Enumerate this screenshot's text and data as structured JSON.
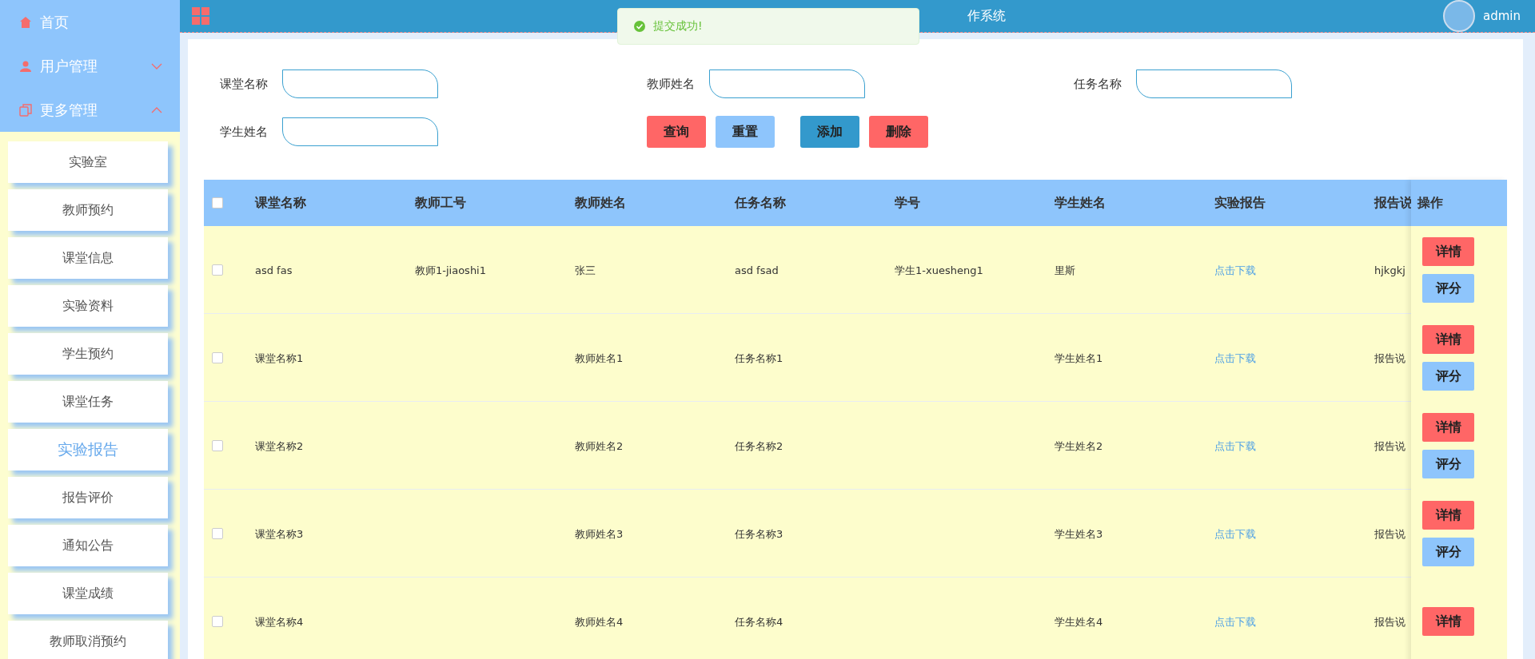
{
  "header": {
    "title_fragment": "作系统",
    "user": "admin"
  },
  "toast": {
    "message": "提交成功!"
  },
  "sidebar": {
    "items": [
      {
        "label": "首页",
        "kind": "link"
      },
      {
        "label": "用户管理",
        "kind": "group",
        "expanded": false
      },
      {
        "label": "更多管理",
        "kind": "group",
        "expanded": true,
        "children": [
          {
            "label": "实验室",
            "selected": false
          },
          {
            "label": "教师预约",
            "selected": false
          },
          {
            "label": "课堂信息",
            "selected": false
          },
          {
            "label": "实验资料",
            "selected": false
          },
          {
            "label": "学生预约",
            "selected": false
          },
          {
            "label": "课堂任务",
            "selected": false
          },
          {
            "label": "实验报告",
            "selected": true
          },
          {
            "label": "报告评价",
            "selected": false
          },
          {
            "label": "通知公告",
            "selected": false
          },
          {
            "label": "课堂成绩",
            "selected": false
          },
          {
            "label": "教师取消预约",
            "selected": false
          }
        ]
      }
    ]
  },
  "search": {
    "fields": [
      {
        "label": "课堂名称"
      },
      {
        "label": "教师姓名"
      },
      {
        "label": "任务名称"
      },
      {
        "label": "学生姓名"
      }
    ],
    "buttons": [
      {
        "label": "查询",
        "kind": "danger"
      },
      {
        "label": "重置",
        "kind": "light"
      },
      {
        "label": "添加",
        "kind": "primary"
      },
      {
        "label": "删除",
        "kind": "danger"
      }
    ]
  },
  "table": {
    "select_all": false,
    "columns": [
      "课堂名称",
      "教师工号",
      "教师姓名",
      "任务名称",
      "学号",
      "学生姓名",
      "实验报告",
      "报告说"
    ],
    "actions_column": "操作",
    "rows": [
      {
        "checked": false,
        "cells": [
          "asd fas",
          "教师1-jiaoshi1",
          "张三",
          "asd fsad",
          "学生1-xuesheng1",
          "里斯",
          "点击下载",
          "hjkgkj"
        ],
        "actions": [
          "详情",
          "评分"
        ]
      },
      {
        "checked": false,
        "cells": [
          "课堂名称1",
          "",
          "教师姓名1",
          "任务名称1",
          "",
          "学生姓名1",
          "点击下载",
          "报告说"
        ],
        "actions": [
          "详情",
          "评分"
        ]
      },
      {
        "checked": false,
        "cells": [
          "课堂名称2",
          "",
          "教师姓名2",
          "任务名称2",
          "",
          "学生姓名2",
          "点击下载",
          "报告说"
        ],
        "actions": [
          "详情",
          "评分"
        ]
      },
      {
        "checked": false,
        "cells": [
          "课堂名称3",
          "",
          "教师姓名3",
          "任务名称3",
          "",
          "学生姓名3",
          "点击下载",
          "报告说"
        ],
        "actions": [
          "详情",
          "评分"
        ]
      },
      {
        "checked": false,
        "cells": [
          "课堂名称4",
          "",
          "教师姓名4",
          "任务名称4",
          "",
          "学生姓名4",
          "点击下载",
          "报告说"
        ],
        "actions": [
          "详情"
        ]
      }
    ]
  }
}
